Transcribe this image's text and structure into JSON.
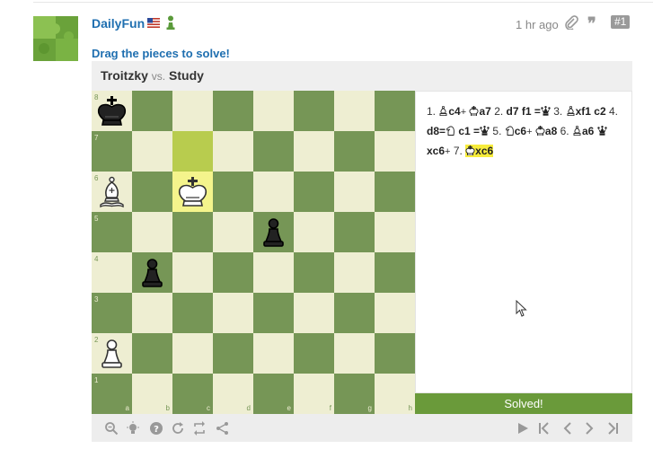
{
  "post": {
    "username": "DailyFun",
    "timestamp": "1 hr ago",
    "badge": "#1",
    "prompt": "Drag the pieces to solve!"
  },
  "game": {
    "white": "Troitzky",
    "vs": "vs.",
    "black": "Study"
  },
  "board": {
    "files": [
      "a",
      "b",
      "c",
      "d",
      "e",
      "f",
      "g",
      "h"
    ],
    "ranks": [
      "8",
      "7",
      "6",
      "5",
      "4",
      "3",
      "2",
      "1"
    ],
    "light_color": "#eeeed2",
    "dark_color": "#769656",
    "highlight_from": "#b8cc4e",
    "highlight_to": "#f4f48c",
    "pieces": [
      {
        "square": "a8",
        "piece": "king",
        "color": "black"
      },
      {
        "square": "a6",
        "piece": "bishop",
        "color": "white"
      },
      {
        "square": "c6",
        "piece": "king",
        "color": "white"
      },
      {
        "square": "e5",
        "piece": "pawn",
        "color": "black"
      },
      {
        "square": "b4",
        "piece": "pawn",
        "color": "black"
      },
      {
        "square": "a2",
        "piece": "pawn",
        "color": "white"
      }
    ]
  },
  "moves": [
    {
      "num": "1.",
      "icon": "bishop",
      "text": "c4",
      "suffix": "+"
    },
    {
      "num": "",
      "icon": "king",
      "text": "a7",
      "suffix": ""
    },
    {
      "num": "2.",
      "icon": "",
      "text": "d7",
      "suffix": ""
    },
    {
      "num": "",
      "icon": "",
      "text": "f1 =",
      "suffix": "",
      "promo": "queen"
    },
    {
      "num": "3.",
      "icon": "bishop",
      "text": "xf1",
      "suffix": ""
    },
    {
      "num": "",
      "icon": "",
      "text": "c2",
      "suffix": ""
    },
    {
      "num": "4.",
      "icon": "",
      "text": "d8=",
      "suffix": "",
      "promo": "knight"
    },
    {
      "num": "",
      "icon": "",
      "text": "c1 =",
      "suffix": "",
      "promo": "queen"
    },
    {
      "num": "5.",
      "icon": "knight",
      "text": "c6",
      "suffix": "+"
    },
    {
      "num": "",
      "icon": "king",
      "text": "a8",
      "suffix": ""
    },
    {
      "num": "6.",
      "icon": "bishop",
      "text": "a6",
      "suffix": ""
    },
    {
      "num": "",
      "icon": "queen",
      "text": "xc6",
      "suffix": "+"
    },
    {
      "num": "7.",
      "icon": "king",
      "text": "xc6",
      "suffix": "",
      "highlight": true
    }
  ],
  "status": "Solved!",
  "colors": {
    "link": "#1f6fb0",
    "solved_bar": "#6a9a3a",
    "move_highlight": "#f7ec3c"
  }
}
